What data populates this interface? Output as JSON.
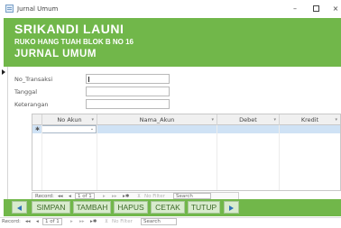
{
  "window": {
    "title": "Jurnal Umum",
    "min_glyph": "–",
    "close_glyph": "×"
  },
  "header": {
    "company": "SRIKANDI LAUNI",
    "address": "RUKO HANG TUAH BLOK B NO 16",
    "form_title": "JURNAL UMUM"
  },
  "fields": [
    {
      "label": "No_Transaksi",
      "value": ""
    },
    {
      "label": "Tanggal",
      "value": ""
    },
    {
      "label": "Keterangan",
      "value": ""
    }
  ],
  "grid": {
    "columns": [
      "No Akun",
      "Nama_Akun",
      "Debet",
      "Kredit"
    ],
    "sort_glyph": "▾",
    "new_row_glyph": "✱",
    "dropdown_glyph": "⌄"
  },
  "subform_nav": {
    "record_label": "Record:",
    "first": "◂◂",
    "prev": "◂",
    "position": "1 of 1",
    "next": "▸",
    "last": "▸▸",
    "new": "▸✱",
    "filter": "No Filter",
    "search": "Search"
  },
  "buttons": {
    "prev_icon": "arrow-left",
    "simpan": "SIMPAN",
    "tambah": "TAMBAH",
    "hapus": "HAPUS",
    "cetak": "CETAK",
    "tutup": "TUTUP",
    "next_icon": "arrow-right"
  },
  "main_nav": {
    "record_label": "Record:",
    "first": "◂◂",
    "prev": "◂",
    "position": "1 of 1",
    "next": "▸",
    "last": "▸▸",
    "new": "▸✱",
    "filter": "No Filter",
    "search": "Search"
  },
  "colors": {
    "header_green": "#71b74a",
    "button_fill": "#d8ebcd",
    "button_text": "#3e6a2a",
    "arrow_blue": "#2f72b8",
    "grid_newrow": "#cfe2f5"
  }
}
